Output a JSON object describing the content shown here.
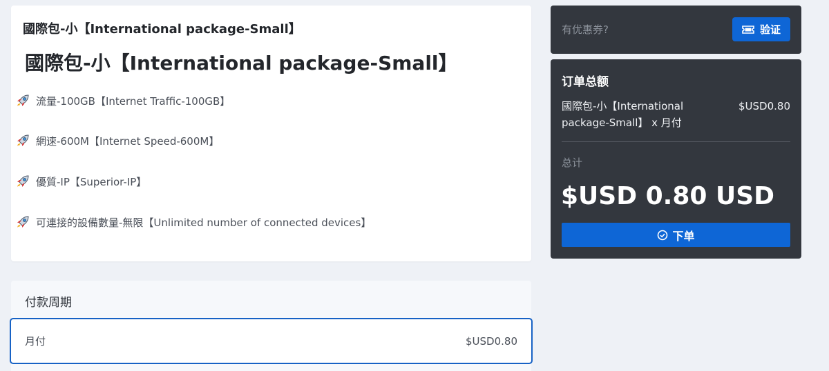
{
  "product": {
    "small_title": "國際包-小【International package-Small】",
    "title": "國際包-小【International package-Small】",
    "features": [
      {
        "icon": "rocket-icon",
        "text": "流量-100GB【Internet Traffic-100GB】"
      },
      {
        "icon": "rocket-icon",
        "text": "網速-600M【Internet Speed-600M】"
      },
      {
        "icon": "rocket-icon",
        "text": "優質-IP【Superior-IP】"
      },
      {
        "icon": "rocket-icon",
        "text": "可連接的設備數量-無限【Unlimited number of connected devices】"
      }
    ]
  },
  "billing": {
    "header": "付款周期",
    "options": [
      {
        "label": "月付",
        "price": "$USD0.80",
        "selected": true
      }
    ]
  },
  "coupon": {
    "placeholder": "有优惠券?",
    "verify_label": "验证",
    "verify_icon": "ticket-icon"
  },
  "summary": {
    "title": "订单总额",
    "item_name": "國際包-小【International package-Small】 x 月付",
    "item_price": "$USD0.80",
    "total_label": "总计",
    "total_amount": "$USD 0.80 USD",
    "order_label": "下单",
    "order_icon": "check-circle-icon"
  },
  "colors": {
    "accent": "#0e66d6",
    "dark_panel": "#33373e",
    "background": "#eef1f6"
  }
}
